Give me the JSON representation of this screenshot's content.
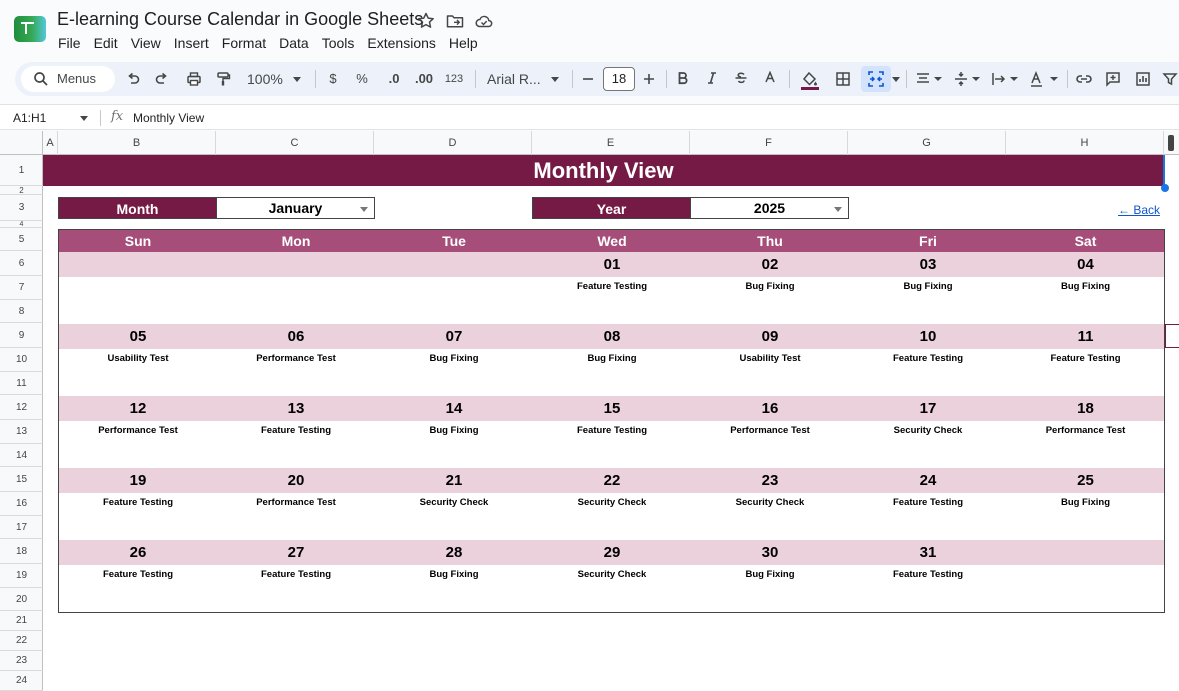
{
  "app": {
    "title": "E-learning Course Calendar in Google Sheets",
    "menu": [
      "File",
      "Edit",
      "View",
      "Insert",
      "Format",
      "Data",
      "Tools",
      "Extensions",
      "Help"
    ]
  },
  "toolbar": {
    "menus_label": "Menus",
    "zoom": "100%",
    "currency": "$",
    "percent": "%",
    "decrease_decimals": ".0",
    "increase_decimals": ".00",
    "number_format": "123",
    "font": "Arial R...",
    "font_size": "18"
  },
  "formula_bar": {
    "name_box": "A1:H1",
    "fx": "fx",
    "value": "Monthly View"
  },
  "grid": {
    "columns": [
      "A",
      "B",
      "C",
      "D",
      "E",
      "F",
      "G",
      "H"
    ],
    "rows": [
      "1",
      "2",
      "3",
      "4",
      "5",
      "6",
      "7",
      "8",
      "9",
      "10",
      "11",
      "12",
      "13",
      "14",
      "15",
      "16",
      "17",
      "18",
      "19",
      "20",
      "21",
      "22",
      "23",
      "24"
    ]
  },
  "sheet": {
    "title": "Monthly View",
    "month_label": "Month",
    "month_value": "January",
    "year_label": "Year",
    "year_value": "2025",
    "back_link": "← Back",
    "day_names": [
      "Sun",
      "Mon",
      "Tue",
      "Wed",
      "Thu",
      "Fri",
      "Sat"
    ],
    "weeks": [
      {
        "dates": [
          "",
          "",
          "",
          "01",
          "02",
          "03",
          "04"
        ],
        "tasks": [
          "",
          "",
          "",
          "Feature Testing",
          "Bug Fixing",
          "Bug Fixing",
          "Bug Fixing"
        ]
      },
      {
        "dates": [
          "05",
          "06",
          "07",
          "08",
          "09",
          "10",
          "11"
        ],
        "tasks": [
          "Usability Test",
          "Performance Test",
          "Bug Fixing",
          "Bug Fixing",
          "Usability Test",
          "Feature Testing",
          "Feature Testing"
        ]
      },
      {
        "dates": [
          "12",
          "13",
          "14",
          "15",
          "16",
          "17",
          "18"
        ],
        "tasks": [
          "Performance Test",
          "Feature Testing",
          "Bug Fixing",
          "Feature Testing",
          "Performance Test",
          "Security Check",
          "Performance Test"
        ]
      },
      {
        "dates": [
          "19",
          "20",
          "21",
          "22",
          "23",
          "24",
          "25"
        ],
        "tasks": [
          "Feature Testing",
          "Performance Test",
          "Security Check",
          "Security Check",
          "Security Check",
          "Feature Testing",
          "Bug Fixing"
        ]
      },
      {
        "dates": [
          "26",
          "27",
          "28",
          "29",
          "30",
          "31",
          ""
        ],
        "tasks": [
          "Feature Testing",
          "Feature Testing",
          "Bug Fixing",
          "Security Check",
          "Bug Fixing",
          "Feature Testing",
          ""
        ]
      }
    ]
  },
  "colors": {
    "title_bg": "#751a45",
    "day_header_bg": "#a64d79",
    "date_band_bg": "#ead1dc",
    "link": "#1155cc"
  }
}
